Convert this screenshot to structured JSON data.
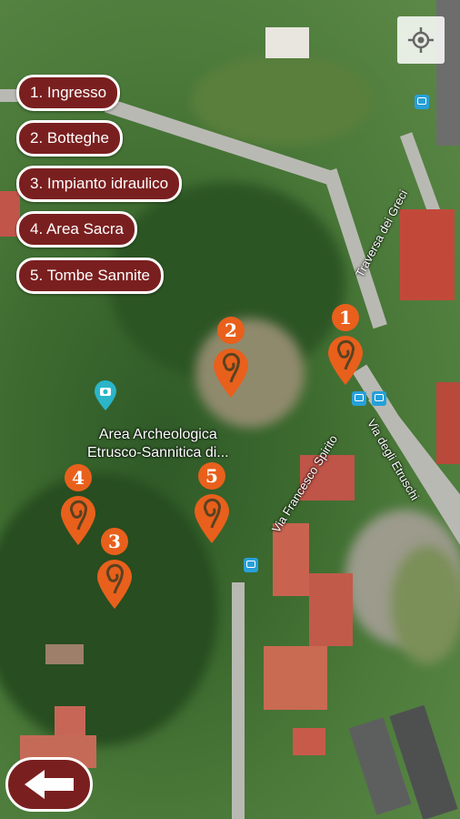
{
  "menu": {
    "items": [
      {
        "label": "1. Ingresso"
      },
      {
        "label": "2. Botteghe"
      },
      {
        "label": "3. Impianto idraulico"
      },
      {
        "label": "4. Area Sacra"
      },
      {
        "label": "5. Tombe Sannite"
      }
    ]
  },
  "markers": [
    {
      "num": "1"
    },
    {
      "num": "2"
    },
    {
      "num": "3"
    },
    {
      "num": "4"
    },
    {
      "num": "5"
    }
  ],
  "map": {
    "place_label_line1": "Area Archeologica",
    "place_label_line2": "Etrusco-Sannitica di...",
    "street_1": "Traversa dei Greci",
    "street_2": "Via degli Etruschi",
    "street_3": "Via Francesco Spirito"
  },
  "icons": {
    "locate": "my-location-icon",
    "back": "back-arrow-icon",
    "place": "camera-pin-icon",
    "bus": "bus-stop-icon"
  },
  "colors": {
    "pill_bg": "#7a1f1f",
    "marker": "#e8601c",
    "place_pin": "#2bb5c9"
  }
}
